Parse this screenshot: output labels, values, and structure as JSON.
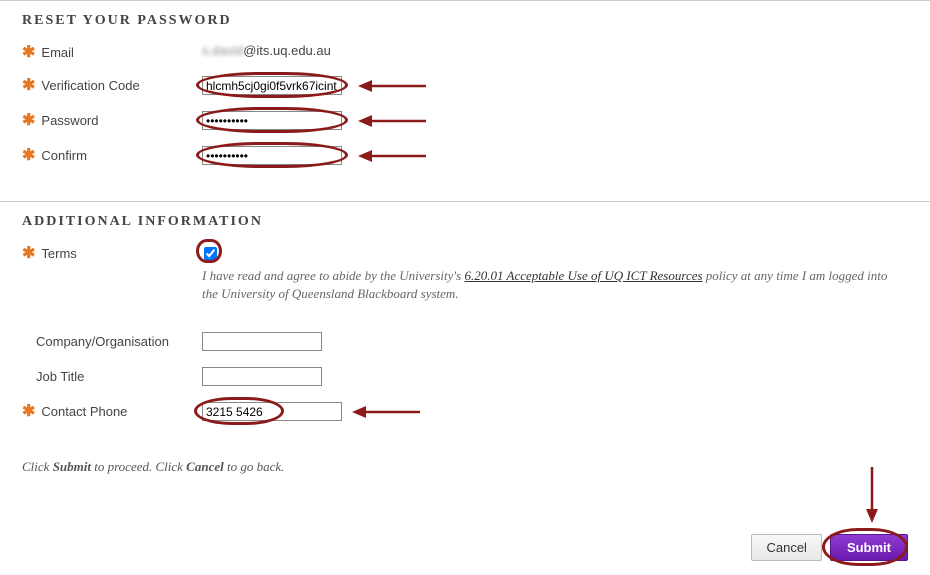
{
  "section1_title": "RESET YOUR PASSWORD",
  "fields": {
    "email": {
      "label": "Email",
      "value_blur": "s.david",
      "value_clear": "@its.uq.edu.au"
    },
    "verification": {
      "label": "Verification Code",
      "value": "hlcmh5cj0gi0f5vrk67icint"
    },
    "password": {
      "label": "Password",
      "value": "••••••••••"
    },
    "confirm": {
      "label": "Confirm",
      "value": "••••••••••"
    }
  },
  "section2_title": "ADDITIONAL INFORMATION",
  "terms": {
    "label": "Terms",
    "checked": true,
    "text_pre": "I have read and agree to abide by the University's ",
    "link_text": "6.20.01 Acceptable Use of UQ ICT Resources",
    "text_post": " policy at any time I am logged into the University of Queensland Blackboard system."
  },
  "company": {
    "label": "Company/Organisation",
    "value": ""
  },
  "jobtitle": {
    "label": "Job Title",
    "value": ""
  },
  "phone": {
    "label": "Contact Phone",
    "value": "3215 5426"
  },
  "footer": {
    "pre1": "Click ",
    "b1": "Submit",
    "mid": " to proceed. Click ",
    "b2": "Cancel",
    "post": " to go back."
  },
  "buttons": {
    "cancel": "Cancel",
    "submit": "Submit"
  }
}
